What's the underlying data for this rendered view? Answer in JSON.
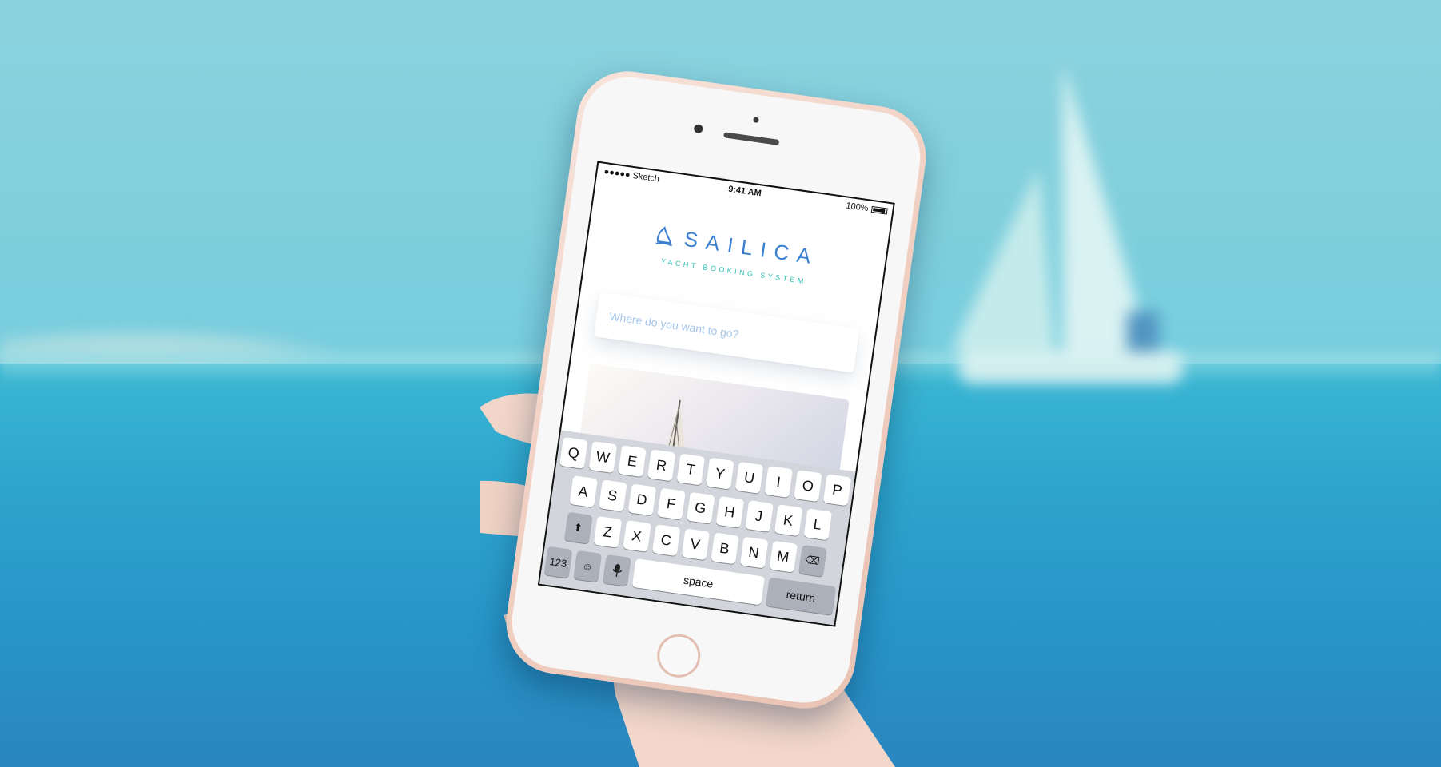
{
  "status_bar": {
    "carrier": "●●●●● Sketch",
    "wifi_icon": "wifi-icon",
    "time": "9:41 AM",
    "battery": "100%"
  },
  "logo": {
    "icon": "sailboat-icon",
    "title": "SAILICA",
    "subtitle": "YACHT BOOKING SYSTEM"
  },
  "search": {
    "placeholder": "Where do you want to go?",
    "value": ""
  },
  "keyboard": {
    "row1": [
      "Q",
      "W",
      "E",
      "R",
      "T",
      "Y",
      "U",
      "I",
      "O",
      "P"
    ],
    "row2": [
      "A",
      "S",
      "D",
      "F",
      "G",
      "H",
      "J",
      "K",
      "L"
    ],
    "row3": [
      "Z",
      "X",
      "C",
      "V",
      "B",
      "N",
      "M"
    ],
    "numbers_label": "123",
    "space_label": "space",
    "return_label": "return",
    "shift_icon": "shift-icon",
    "emoji_icon": "emoji-icon",
    "mic_icon": "microphone-icon",
    "delete_icon": "delete-icon"
  },
  "colors": {
    "brand_blue": "#3b7fd1",
    "brand_teal": "#2fbfb5",
    "placeholder_blue": "#a8c7ee"
  }
}
